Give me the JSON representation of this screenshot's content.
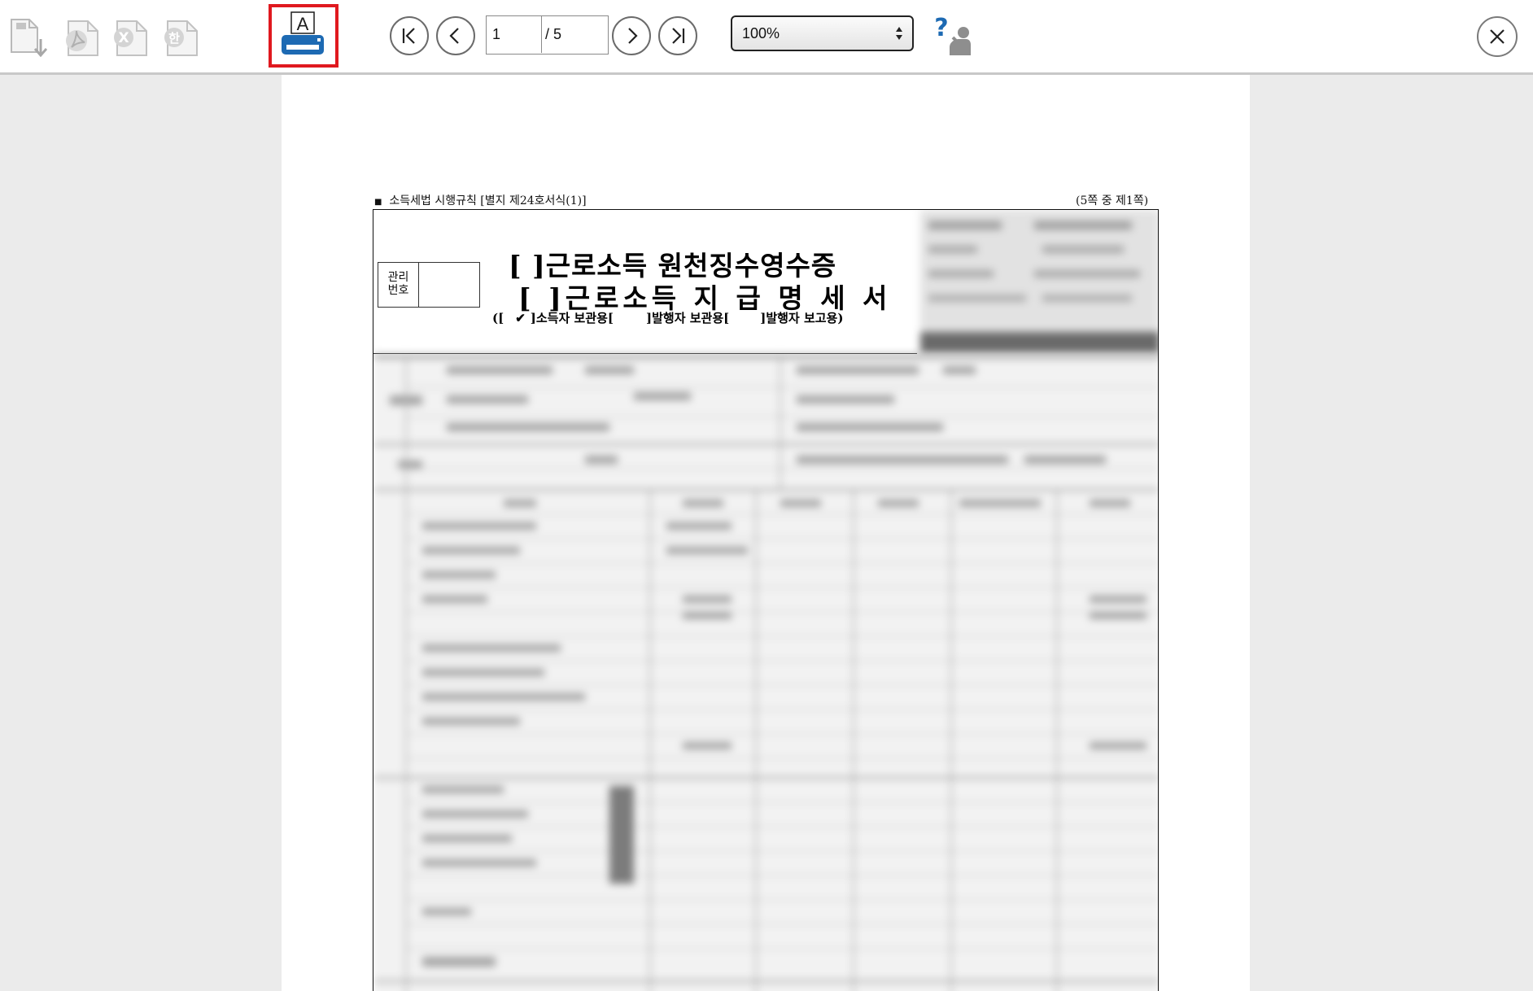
{
  "toolbar": {
    "buttons": [
      {
        "name": "save-download",
        "icon": "save-download-icon"
      },
      {
        "name": "export-pdf",
        "icon": "pdf-icon"
      },
      {
        "name": "export-excel",
        "icon": "excel-icon"
      },
      {
        "name": "export-hwp",
        "icon": "hwp-icon"
      },
      {
        "name": "print",
        "icon": "print-icon"
      },
      {
        "name": "help",
        "icon": "help-icon"
      },
      {
        "name": "close",
        "icon": "close-icon"
      }
    ],
    "pagination": {
      "current_page": "1",
      "total_label": "/ 5"
    },
    "zoom": {
      "value": "100%"
    },
    "print_highlight_color": "#e0191f",
    "accent_color": "#1d6ab3"
  },
  "document": {
    "header_left": "소득세법 시행규칙 [별지 제24호서식(1)]",
    "header_right": "(5쪽 중 제1쪽)",
    "mgmt_label": "관리\n번호",
    "title_line1": "[   ]근로소득 원천징수영수증",
    "title_line2": "[   ]근로소득 지 급 명 세 서",
    "copies": {
      "open": "([",
      "check": "✔",
      "income_earner": "]소득자 보관용[",
      "issuer_keep": "]발행자 보관용[",
      "issuer_report": "]발행자 보고용)"
    }
  }
}
